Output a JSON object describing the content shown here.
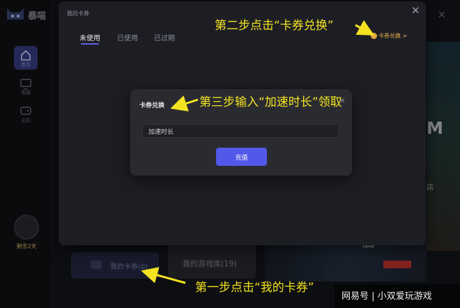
{
  "app": {
    "logo_text": "暴喵",
    "nav": [
      {
        "label": "首页",
        "icon": "home-icon"
      },
      {
        "label": "电脑",
        "icon": "monitor-icon"
      },
      {
        "label": "主机",
        "icon": "gamepad-icon"
      }
    ],
    "days_left": "剩余2天"
  },
  "background": {
    "banner_letter": "M",
    "banner_text": "店",
    "promo_text": "启",
    "cards": {
      "my_coupons": "我的卡券(0)",
      "game_library": "我的游戏库(19)"
    }
  },
  "coupon_dialog": {
    "title": "我的卡券",
    "tabs": [
      "未使用",
      "已使用",
      "已过期"
    ],
    "active_tab": "未使用",
    "redeem_link": "卡券兑换 >"
  },
  "redeem_dialog": {
    "title": "卡券兑换",
    "input_value": "加速时长",
    "submit_label": "充值"
  },
  "annotations": {
    "step1": "第一步点击“我的卡券”",
    "step2": "第二步点击“卡券兑换”",
    "step3": "第三步输入“加速时长”领取",
    "color": "#f3e321"
  },
  "watermark": "网易号 | 小双爱玩游戏",
  "colors": {
    "accent": "#5358ea",
    "redeem_link": "#e9b44e"
  }
}
